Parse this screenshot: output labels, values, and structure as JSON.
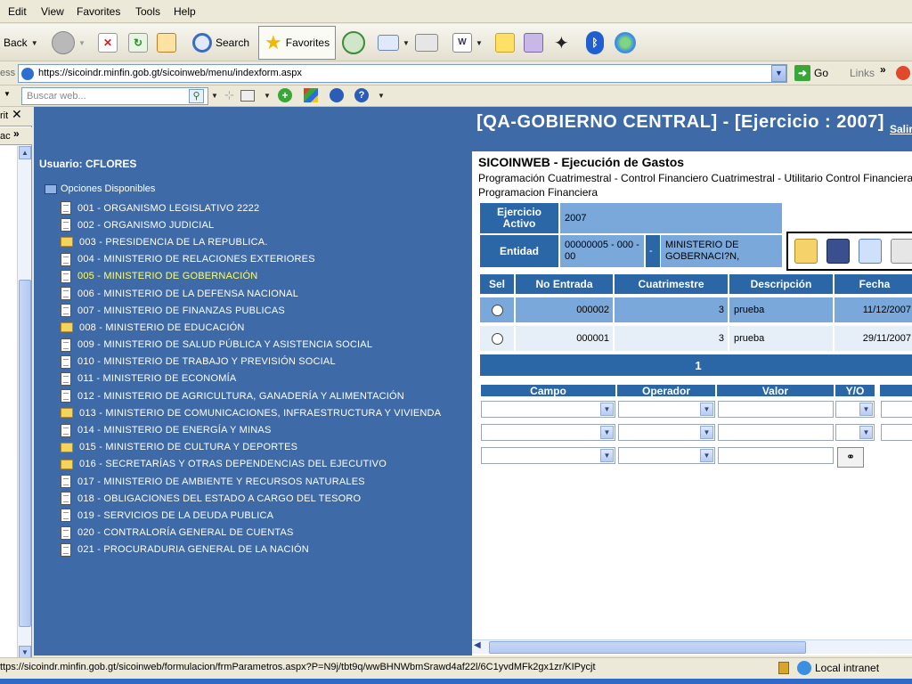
{
  "menu": {
    "items": [
      "Edit",
      "View",
      "Favorites",
      "Tools",
      "Help"
    ]
  },
  "toolbar": {
    "back_label": "Back",
    "search_label": "Search",
    "favorites_label": "Favorites"
  },
  "address": {
    "label": "ess",
    "url": "https://sicoindr.minfin.gob.gt/sicoinweb/menu/indexform.aspx",
    "go_label": "Go",
    "links_label": "Links"
  },
  "searchbar": {
    "placeholder": "Buscar web..."
  },
  "leftpane": {
    "header_text": "rit",
    "sub_text": "ac"
  },
  "nav": {
    "usuario": "Usuario: CFLORES",
    "opciones": "Opciones Disponibles",
    "items": [
      {
        "label": "001 - ORGANISMO LEGISLATIVO 2222",
        "icon": "document-icon"
      },
      {
        "label": "002 - ORGANISMO JUDICIAL",
        "icon": "document-icon"
      },
      {
        "label": "003 - PRESIDENCIA DE LA REPUBLICA.",
        "icon": "folder-icon"
      },
      {
        "label": "004 - MINISTERIO DE RELACIONES EXTERIORES",
        "icon": "document-icon"
      },
      {
        "label": "005 - MINISTERIO DE GOBERNACIÓN",
        "icon": "document-icon",
        "selected": true
      },
      {
        "label": "006 - MINISTERIO DE LA DEFENSA NACIONAL",
        "icon": "document-icon"
      },
      {
        "label": "007 - MINISTERIO DE FINANZAS PUBLICAS",
        "icon": "document-icon"
      },
      {
        "label": "008 - MINISTERIO DE EDUCACIÓN",
        "icon": "folder-icon"
      },
      {
        "label": "009 - MINISTERIO DE SALUD PÚBLICA Y ASISTENCIA SOCIAL",
        "icon": "document-icon"
      },
      {
        "label": "010 - MINISTERIO DE TRABAJO Y PREVISIÓN SOCIAL",
        "icon": "document-icon"
      },
      {
        "label": "011 - MINISTERIO DE ECONOMÍA",
        "icon": "document-icon"
      },
      {
        "label": "012 - MINISTERIO DE AGRICULTURA, GANADERÍA Y ALIMENTACIÓN",
        "icon": "document-icon"
      },
      {
        "label": "013 - MINISTERIO DE COMUNICACIONES, INFRAESTRUCTURA Y VIVIENDA",
        "icon": "folder-icon"
      },
      {
        "label": "014 - MINISTERIO DE ENERGÍA Y MINAS",
        "icon": "document-icon"
      },
      {
        "label": "015 - MINISTERIO DE CULTURA Y DEPORTES",
        "icon": "folder-icon"
      },
      {
        "label": "016 - SECRETARÍAS Y OTRAS DEPENDENCIAS DEL EJECUTIVO",
        "icon": "folder-icon"
      },
      {
        "label": "017 - MINISTERIO DE AMBIENTE Y RECURSOS NATURALES",
        "icon": "document-icon"
      },
      {
        "label": "018 - OBLIGACIONES DEL ESTADO A CARGO DEL TESORO",
        "icon": "document-icon"
      },
      {
        "label": "019 - SERVICIOS DE LA DEUDA PUBLICA",
        "icon": "document-icon"
      },
      {
        "label": "020 - CONTRALORÍA GENERAL DE CUENTAS",
        "icon": "document-icon"
      },
      {
        "label": "021 - PROCURADURIA GENERAL DE LA NACIÓN",
        "icon": "document-icon"
      }
    ]
  },
  "content": {
    "title": "[QA-GOBIERNO CENTRAL] - [Ejercicio : 2007]",
    "salir": "Salir",
    "module_title": "SICOINWEB - Ejecución de Gastos",
    "module_links": "Programación Cuatrimestral - Control Financiero Cuatrimestral - Utilitario Control Financiera - Utilitario de Programacion Financiera",
    "ejercicio_label": "Ejercicio Activo",
    "ejercicio_value": "2007",
    "entidad_label": "Entidad",
    "entidad_code": "00000005 - 000 - 00",
    "entidad_sep": "-",
    "entidad_name": "MINISTERIO DE GOBERNACI?N,",
    "table": {
      "headers": [
        "Sel",
        "No Entrada",
        "Cuatrimestre",
        "Descripción",
        "Fecha"
      ],
      "rows": [
        {
          "no_entrada": "000002",
          "cuatrimestre": "3",
          "descripcion": "prueba",
          "fecha": "11/12/2007"
        },
        {
          "no_entrada": "000001",
          "cuatrimestre": "3",
          "descripcion": "prueba",
          "fecha": "29/11/2007"
        }
      ],
      "page": "1"
    },
    "filter": {
      "headers": [
        "Campo",
        "Operador",
        "Valor",
        "Y/O"
      ]
    }
  },
  "status": {
    "url": "ttps://sicoindr.minfin.gob.gt/sicoinweb/formulacion/frmParametros.aspx?P=N9j/tbt9q/wwBHNWbmSrawd4af22l/6C1yvdMFk2gx1zr/KIPycjt",
    "zone": "Local intranet"
  },
  "colors": {
    "nav_bg": "#3e6aa7",
    "header_blue": "#2b66a6",
    "row_highlight": "#7aa8db",
    "selected_item": "#ffff66"
  }
}
